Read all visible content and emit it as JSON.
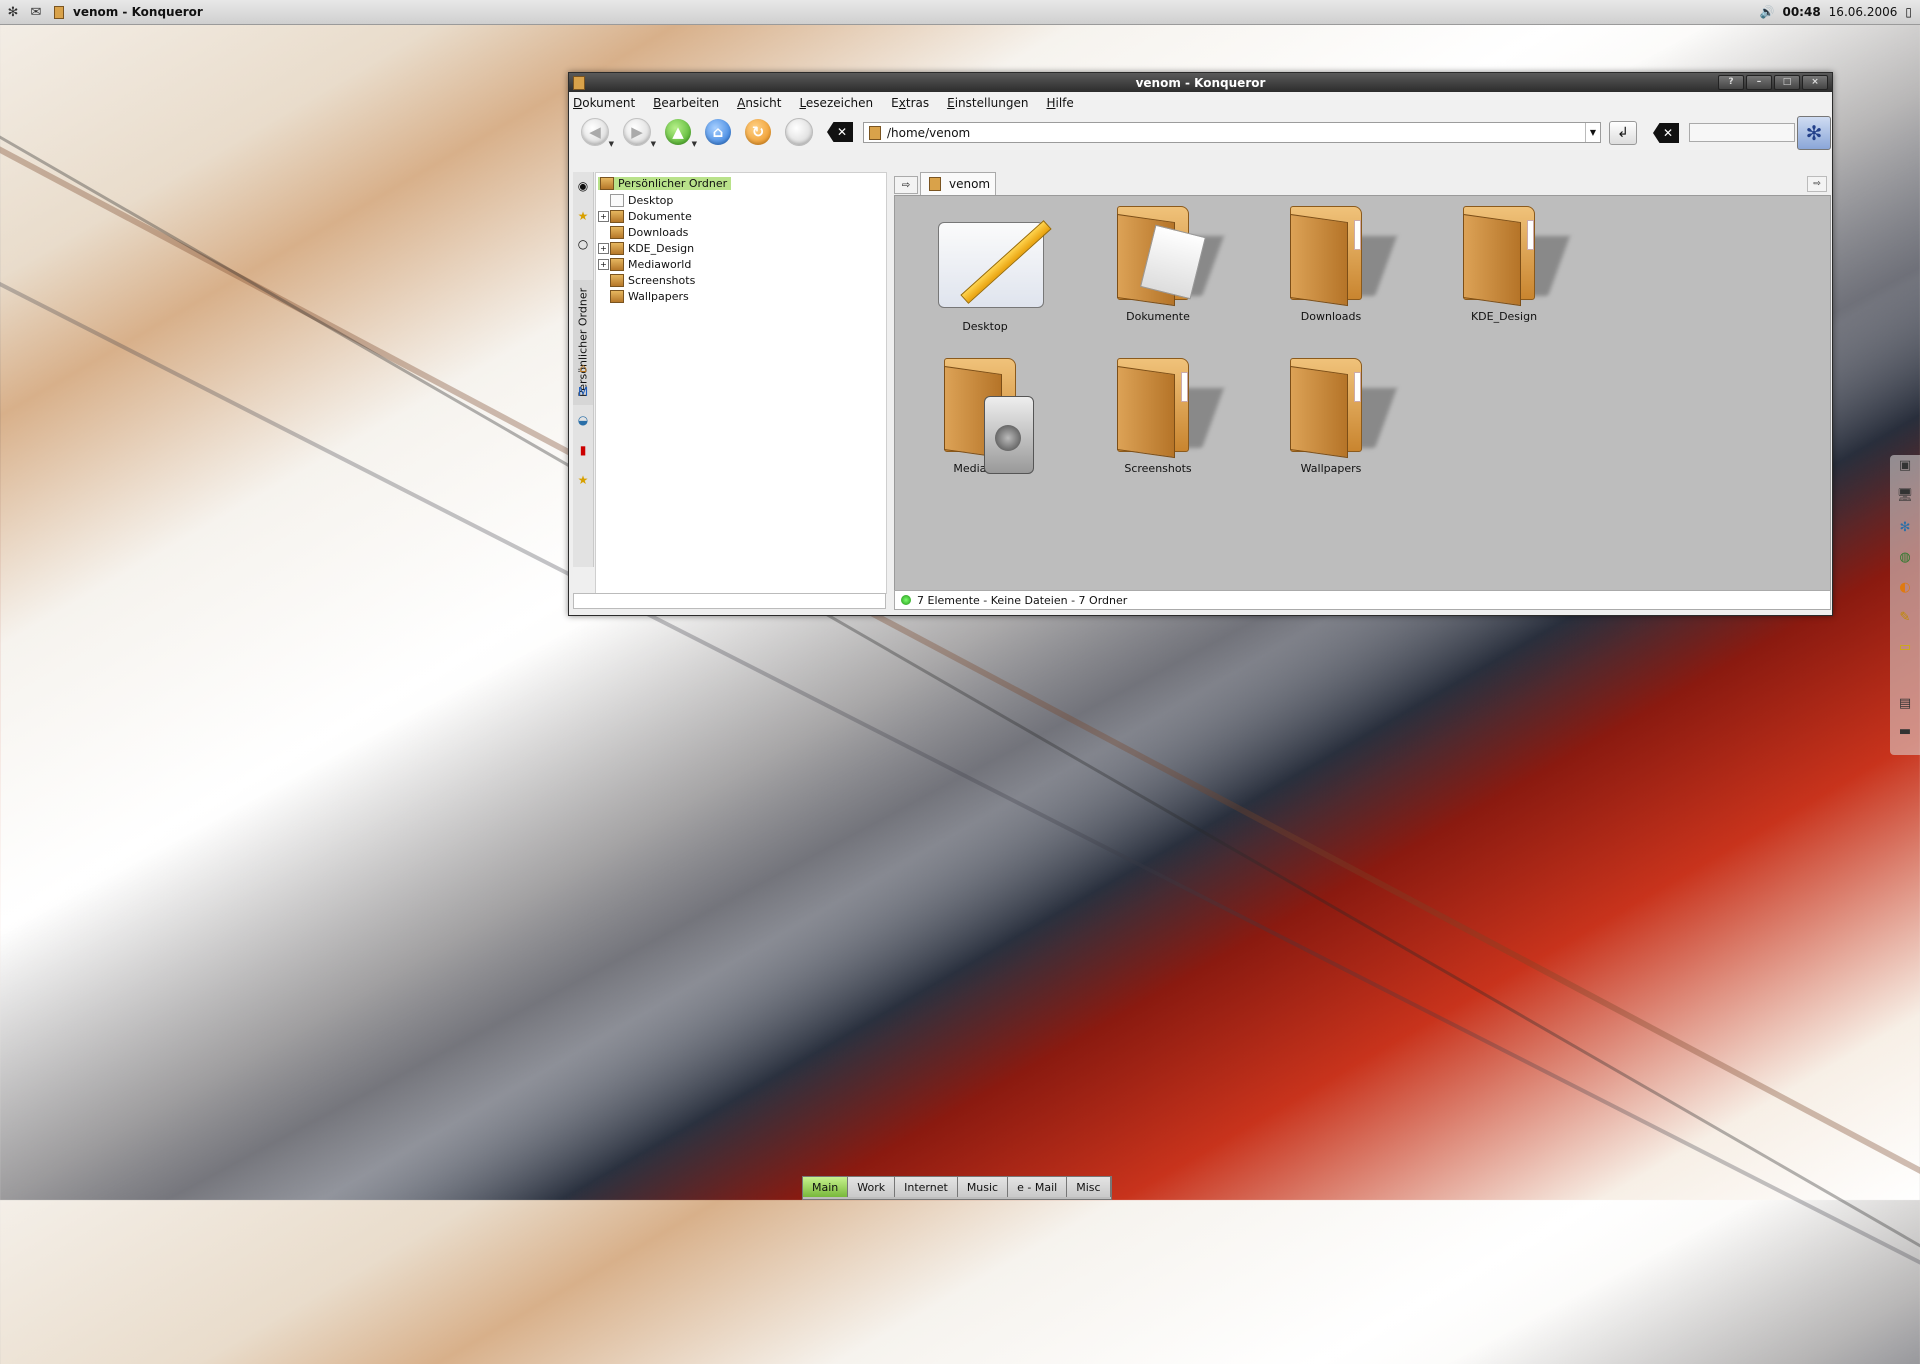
{
  "top_panel": {
    "task_title": "venom - Konqueror",
    "clock_time": "00:48",
    "clock_date": "16.06.2006",
    "icons": [
      "kde-menu-icon",
      "mail-icon",
      "konqueror-task-icon",
      "volume-icon"
    ]
  },
  "window": {
    "title": "venom - Konqueror",
    "title_buttons": [
      "?",
      "–",
      "□",
      "×"
    ]
  },
  "menubar": {
    "items": [
      {
        "label": "Dokument",
        "accel": "D"
      },
      {
        "label": "Bearbeiten",
        "accel": "B"
      },
      {
        "label": "Ansicht",
        "accel": "A"
      },
      {
        "label": "Lesezeichen",
        "accel": "L"
      },
      {
        "label": "Extras",
        "accel": "x"
      },
      {
        "label": "Einstellungen",
        "accel": "E"
      },
      {
        "label": "Hilfe",
        "accel": "H"
      }
    ]
  },
  "toolbar": {
    "buttons": [
      "back",
      "forward",
      "up",
      "home",
      "reload",
      "stop"
    ],
    "location": "/home/venom",
    "search_value": ""
  },
  "sidebar": {
    "vertical_tab": "Persönlicher Ordner",
    "root": "Persönlicher Ordner",
    "items": [
      {
        "label": "Desktop",
        "expandable": false
      },
      {
        "label": "Dokumente",
        "expandable": true
      },
      {
        "label": "Downloads",
        "expandable": false
      },
      {
        "label": "KDE_Design",
        "expandable": true
      },
      {
        "label": "Mediaworld",
        "expandable": true
      },
      {
        "label": "Screenshots",
        "expandable": false
      },
      {
        "label": "Wallpapers",
        "expandable": false
      }
    ]
  },
  "tabs": [
    {
      "label": "venom"
    }
  ],
  "icons": [
    {
      "label": "Desktop",
      "type": "desktop"
    },
    {
      "label": "Dokumente",
      "type": "folder-docs"
    },
    {
      "label": "Downloads",
      "type": "folder"
    },
    {
      "label": "KDE_Design",
      "type": "folder"
    },
    {
      "label": "Mediaworld",
      "type": "folder-media"
    },
    {
      "label": "Screenshots",
      "type": "folder"
    },
    {
      "label": "Wallpapers",
      "type": "folder"
    }
  ],
  "status": "7 Elemente - Keine Dateien - 7 Ordner",
  "pager": {
    "desktops": [
      "Main",
      "Work",
      "Internet",
      "Music",
      "e - Mail",
      "Misc"
    ],
    "active": "Main"
  },
  "colors": {
    "selection": "#b9e28a",
    "iconview_bg": "#bdbdbd",
    "folder": "#d9a24a",
    "titlebar": "#2c2c2c"
  }
}
